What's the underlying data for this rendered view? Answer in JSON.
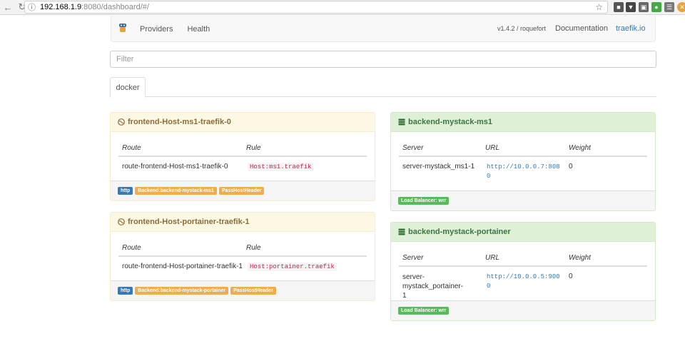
{
  "browser": {
    "url_host": "192.168.1.9",
    "url_path": ":8080/dashboard/#/"
  },
  "navbar": {
    "providers": "Providers",
    "health": "Health",
    "version": "v1.4.2 / roquefort",
    "documentation": "Documentation",
    "site_link": "traefik.io"
  },
  "filter": {
    "placeholder": "Filter"
  },
  "tabs": [
    {
      "label": "docker"
    }
  ],
  "frontends": [
    {
      "title": "frontend-Host-ms1-traefik-0",
      "col_route": "Route",
      "col_rule": "Rule",
      "route": "route-frontend-Host-ms1-traefik-0",
      "rule": "Host:ms1.traefik",
      "labels": [
        "http",
        "Backend:backend-mystack-ms1",
        "PassHostHeader"
      ]
    },
    {
      "title": "frontend-Host-portainer-traefik-1",
      "col_route": "Route",
      "col_rule": "Rule",
      "route": "route-frontend-Host-portainer-traefik-1",
      "rule": "Host:portainer.traefik",
      "labels": [
        "http",
        "Backend:backend-mystack-portainer",
        "PassHostHeader"
      ]
    }
  ],
  "backends": [
    {
      "title": "backend-mystack-ms1",
      "col_server": "Server",
      "col_url": "URL",
      "col_weight": "Weight",
      "server": "server-mystack_ms1-1",
      "url": "http://10.0.0.7:8080",
      "weight": "0",
      "lb": "Load Balancer: wrr"
    },
    {
      "title": "backend-mystack-portainer",
      "col_server": "Server",
      "col_url": "URL",
      "col_weight": "Weight",
      "server": "server-mystack_portainer-1",
      "url": "http://10.0.0.5:9000",
      "weight": "0",
      "lb": "Load Balancer: wrr"
    }
  ],
  "colors": {
    "warning_bg": "#fcf8e3",
    "success_bg": "#dff0d8",
    "label_primary": "#337ab7",
    "label_warning": "#f0ad4e",
    "label_success": "#5cb85c"
  }
}
